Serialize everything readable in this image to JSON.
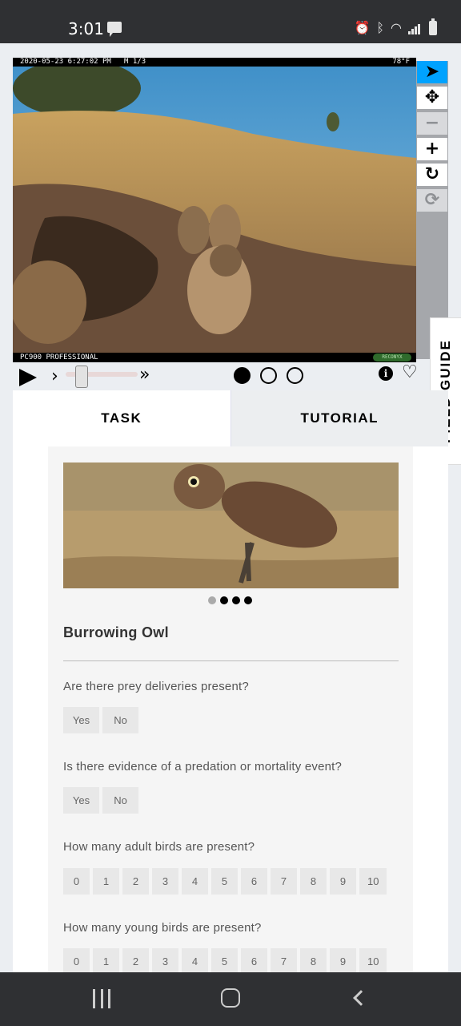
{
  "status_bar": {
    "time": "3:01"
  },
  "viewer": {
    "caption_top": "2020-05-23 6:27:02 PM   M 1/3",
    "temperature": "78°F",
    "caption_bottom": "PC900 PROFESSIONAL",
    "brand": "RECONYX",
    "frames": [
      {
        "active": true
      },
      {
        "active": false
      },
      {
        "active": false
      }
    ],
    "tools": [
      "pointer-icon",
      "move-icon",
      "zoom-out-icon",
      "zoom-in-icon",
      "rotate-icon",
      "reset-icon"
    ]
  },
  "field_guide": {
    "label": "FIELD GUIDE"
  },
  "tabs": {
    "task": "TASK",
    "tutorial": "TUTORIAL"
  },
  "task": {
    "species": "Burrowing Owl",
    "questions": [
      {
        "text": "Are there prey deliveries present?",
        "answers": [
          "Yes",
          "No"
        ]
      },
      {
        "text": "Is there evidence of a predation or mortality event?",
        "answers": [
          "Yes",
          "No"
        ]
      },
      {
        "text": "How many adult birds are present?",
        "answers": [
          "0",
          "1",
          "2",
          "3",
          "4",
          "5",
          "6",
          "7",
          "8",
          "9",
          "10"
        ]
      },
      {
        "text": "How many young birds are present?",
        "answers": [
          "0",
          "1",
          "2",
          "3",
          "4",
          "5",
          "6",
          "7",
          "8",
          "9",
          "10"
        ]
      }
    ]
  }
}
